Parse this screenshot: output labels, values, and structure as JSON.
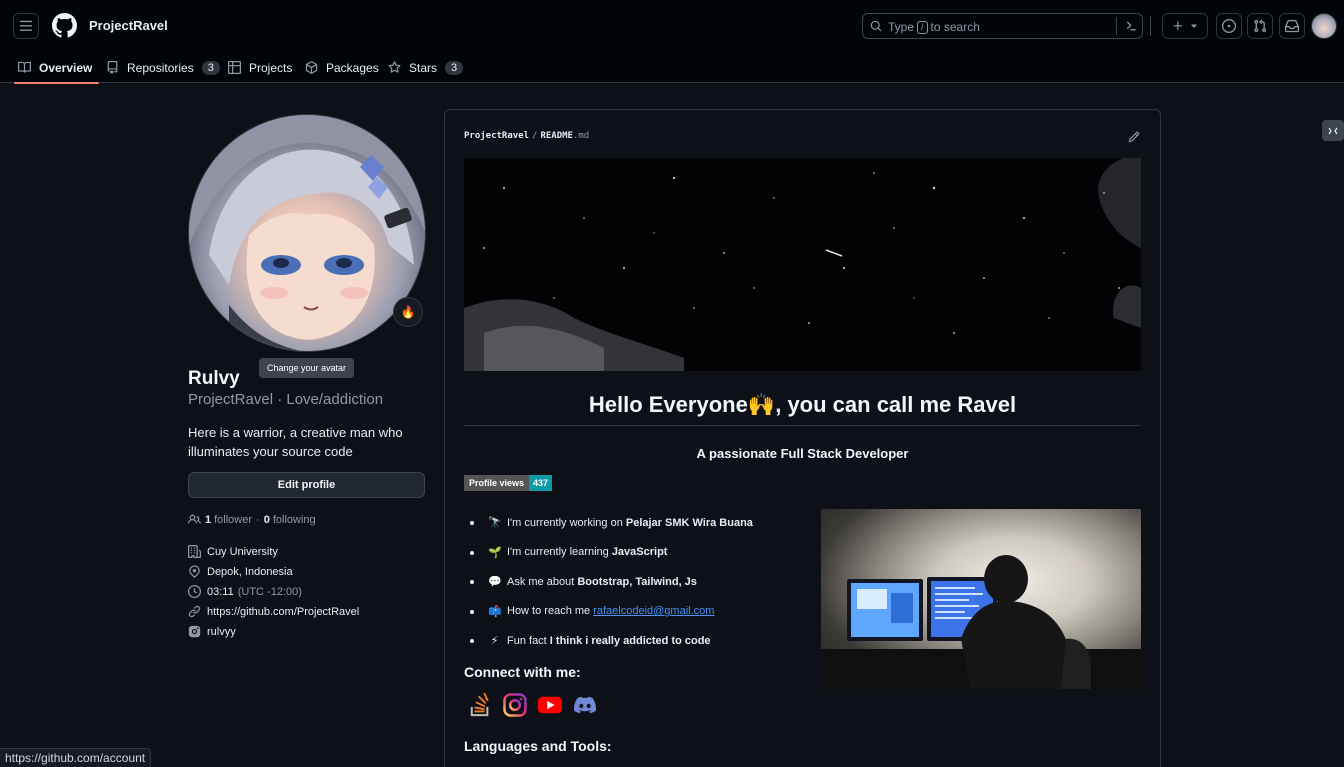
{
  "header": {
    "context_name": "ProjectRavel",
    "search": {
      "prefix": "Type",
      "key": "/",
      "suffix": "to search"
    },
    "tabs": [
      {
        "label": "Overview",
        "icon": "book-icon"
      },
      {
        "label": "Repositories",
        "count": "3",
        "icon": "repo-icon"
      },
      {
        "label": "Projects",
        "icon": "table-icon"
      },
      {
        "label": "Packages",
        "icon": "package-icon"
      },
      {
        "label": "Stars",
        "count": "3",
        "icon": "star-icon"
      }
    ]
  },
  "profile": {
    "status_emoji": "🔥",
    "avatar_tooltip": "Change your avatar",
    "name": "Rulvy",
    "login_line": "ProjectRavel · Love/addiction",
    "bio": "Here is a warrior, a creative man who illuminates your source code",
    "edit_label": "Edit profile",
    "followers": {
      "count": "1",
      "label": "follower",
      "sep": "·",
      "following_count": "0",
      "following_label": "following"
    },
    "vcard": {
      "org": "Cuy University",
      "location": "Depok, Indonesia",
      "time": "03:11",
      "tz": "(UTC -12:00)",
      "url": "https://github.com/ProjectRavel",
      "instagram": "rulvyy"
    }
  },
  "readme": {
    "crumb_owner": "ProjectRavel",
    "crumb_sep": "/",
    "crumb_file": "README",
    "crumb_ext": ".md",
    "heading": "Hello Everyone🙌, you can call me Ravel",
    "subheading": "A passionate Full Stack Developer",
    "profile_views_label": "Profile views",
    "profile_views_value": "437",
    "bullets": [
      {
        "emoji": "🔭",
        "text": "I'm currently working on ",
        "bold": "Pelajar SMK Wira Buana"
      },
      {
        "emoji": "🌱",
        "text": "I'm currently learning ",
        "bold": "JavaScript"
      },
      {
        "emoji": "💬",
        "text": "Ask me about ",
        "bold": "Bootstrap, Tailwind, Js"
      },
      {
        "emoji": "📫",
        "text": "How to reach me ",
        "link": "rafaelcodeid@gmail.com"
      },
      {
        "emoji": "⚡",
        "text": "Fun fact ",
        "bold": "I think i really addicted to code"
      }
    ],
    "connect_heading": "Connect with me:",
    "languages_heading": "Languages and Tools:"
  },
  "colors": {
    "accent_underline": "#f78166",
    "link": "#4493f8",
    "badge_value": "#0e9ba8"
  },
  "statusbar_url": "https://github.com/account"
}
